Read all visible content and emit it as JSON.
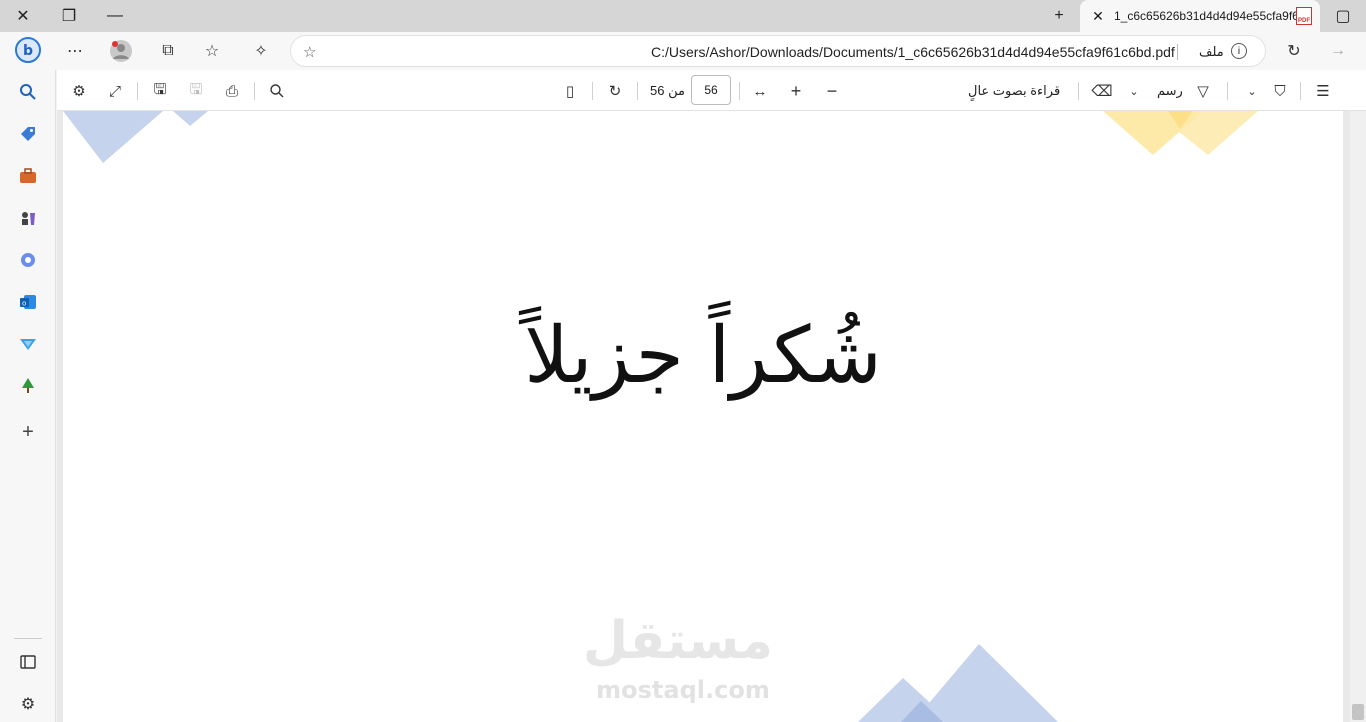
{
  "tab": {
    "title": "1_c6c65626b31d4d4d94e55cfa9f61c6bd.pdf",
    "file_badge": "PDF"
  },
  "address": {
    "url": "C:/Users/Ashor/Downloads/Documents/1_c6c65626b31d4d4d94e55cfa9f61c6bd.pdf",
    "file_label": "ملف"
  },
  "pdf_toolbar": {
    "page_current": "56",
    "page_of": "من 56",
    "read_aloud": "قراءة بصوت عالٍ",
    "draw_label": "رسم"
  },
  "document": {
    "calligraphy": "شُكراً جزيلاً",
    "watermark_ar": "مستقل",
    "watermark_en": "mostaql.com"
  },
  "colors": {
    "blue_shape": "#c5d3ec",
    "yellow_shape": "#fde9a8"
  }
}
